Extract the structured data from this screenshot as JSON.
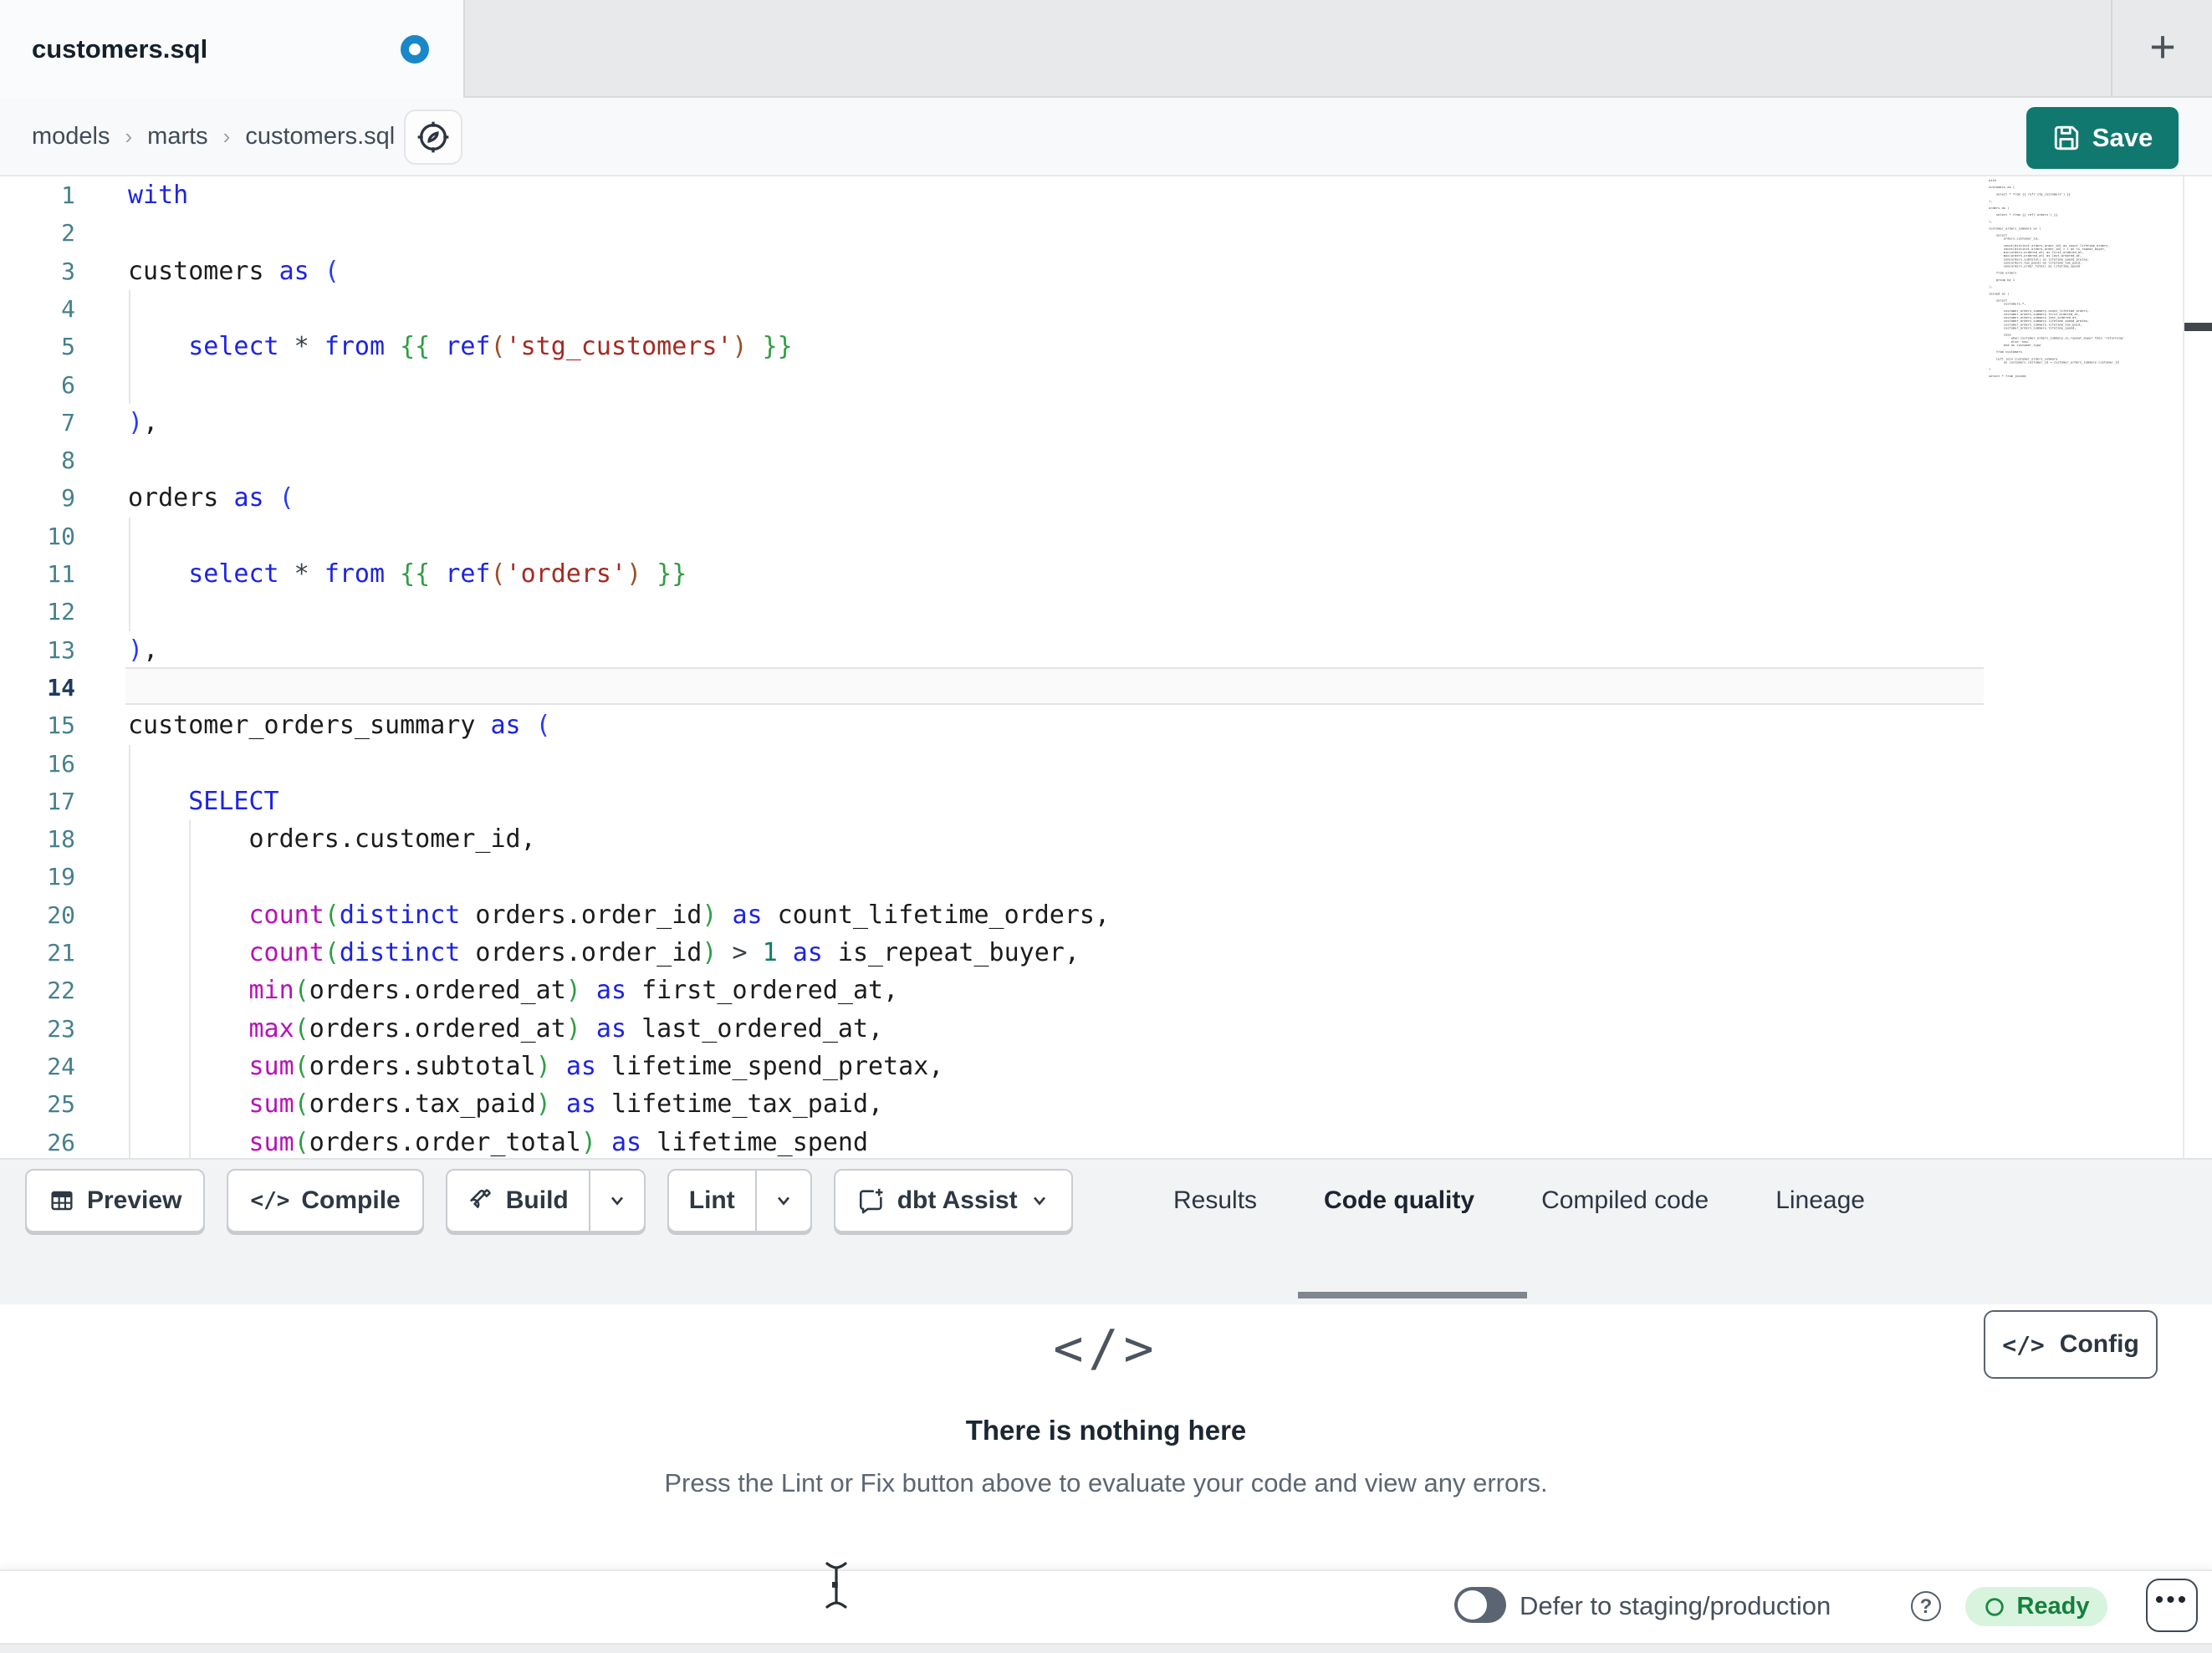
{
  "tabbar": {
    "tab_title": "customers.sql",
    "new_tab_label": "+"
  },
  "breadcrumb": {
    "items": [
      "models",
      "marts",
      "customers.sql"
    ],
    "separator": "›"
  },
  "save": {
    "label": "Save"
  },
  "editor": {
    "active_line": 14,
    "lines": [
      {
        "n": 1,
        "t": [
          [
            "kw",
            "with"
          ]
        ]
      },
      {
        "n": 2,
        "t": []
      },
      {
        "n": 3,
        "t": [
          [
            "id",
            "customers "
          ],
          [
            "kw",
            "as"
          ],
          [
            "id",
            " "
          ],
          [
            "pb",
            "("
          ]
        ]
      },
      {
        "n": 4,
        "t": []
      },
      {
        "n": 5,
        "t": [
          [
            "id",
            "    "
          ],
          [
            "kw",
            "select"
          ],
          [
            "op",
            " * "
          ],
          [
            "kw",
            "from"
          ],
          [
            "id",
            " "
          ],
          [
            "jj",
            "{{"
          ],
          [
            "id",
            " "
          ],
          [
            "kw",
            "ref"
          ],
          [
            "jp",
            "("
          ],
          [
            "str",
            "'stg_customers'"
          ],
          [
            "jp",
            ")"
          ],
          [
            "id",
            " "
          ],
          [
            "jj",
            "}}"
          ]
        ]
      },
      {
        "n": 6,
        "t": []
      },
      {
        "n": 7,
        "t": [
          [
            "pb",
            ")"
          ],
          [
            "id",
            ","
          ]
        ]
      },
      {
        "n": 8,
        "t": []
      },
      {
        "n": 9,
        "t": [
          [
            "id",
            "orders "
          ],
          [
            "kw",
            "as"
          ],
          [
            "id",
            " "
          ],
          [
            "pb",
            "("
          ]
        ]
      },
      {
        "n": 10,
        "t": []
      },
      {
        "n": 11,
        "t": [
          [
            "id",
            "    "
          ],
          [
            "kw",
            "select"
          ],
          [
            "op",
            " * "
          ],
          [
            "kw",
            "from"
          ],
          [
            "id",
            " "
          ],
          [
            "jj",
            "{{"
          ],
          [
            "id",
            " "
          ],
          [
            "kw",
            "ref"
          ],
          [
            "jp",
            "("
          ],
          [
            "str",
            "'orders'"
          ],
          [
            "jp",
            ")"
          ],
          [
            "id",
            " "
          ],
          [
            "jj",
            "}}"
          ]
        ]
      },
      {
        "n": 12,
        "t": []
      },
      {
        "n": 13,
        "t": [
          [
            "pb",
            ")"
          ],
          [
            "id",
            ","
          ]
        ]
      },
      {
        "n": 14,
        "t": []
      },
      {
        "n": 15,
        "t": [
          [
            "id",
            "customer_orders_summary "
          ],
          [
            "kw",
            "as"
          ],
          [
            "id",
            " "
          ],
          [
            "pb",
            "("
          ]
        ]
      },
      {
        "n": 16,
        "t": []
      },
      {
        "n": 17,
        "t": [
          [
            "id",
            "    "
          ],
          [
            "kw",
            "SELECT"
          ]
        ]
      },
      {
        "n": 18,
        "t": [
          [
            "id",
            "        orders.customer_id,"
          ]
        ]
      },
      {
        "n": 19,
        "t": []
      },
      {
        "n": 20,
        "t": [
          [
            "id",
            "        "
          ],
          [
            "fn",
            "count"
          ],
          [
            "pg",
            "("
          ],
          [
            "kw",
            "distinct"
          ],
          [
            "id",
            " orders.order_id"
          ],
          [
            "pg",
            ")"
          ],
          [
            "id",
            " "
          ],
          [
            "kw",
            "as"
          ],
          [
            "id",
            " count_lifetime_orders,"
          ]
        ]
      },
      {
        "n": 21,
        "t": [
          [
            "id",
            "        "
          ],
          [
            "fn",
            "count"
          ],
          [
            "pg",
            "("
          ],
          [
            "kw",
            "distinct"
          ],
          [
            "id",
            " orders.order_id"
          ],
          [
            "pg",
            ")"
          ],
          [
            "op",
            " > "
          ],
          [
            "num",
            "1"
          ],
          [
            "id",
            " "
          ],
          [
            "kw",
            "as"
          ],
          [
            "id",
            " is_repeat_buyer,"
          ]
        ]
      },
      {
        "n": 22,
        "t": [
          [
            "id",
            "        "
          ],
          [
            "fn",
            "min"
          ],
          [
            "pg",
            "("
          ],
          [
            "id",
            "orders.ordered_at"
          ],
          [
            "pg",
            ")"
          ],
          [
            "id",
            " "
          ],
          [
            "kw",
            "as"
          ],
          [
            "id",
            " first_ordered_at,"
          ]
        ]
      },
      {
        "n": 23,
        "t": [
          [
            "id",
            "        "
          ],
          [
            "fn",
            "max"
          ],
          [
            "pg",
            "("
          ],
          [
            "id",
            "orders.ordered_at"
          ],
          [
            "pg",
            ")"
          ],
          [
            "id",
            " "
          ],
          [
            "kw",
            "as"
          ],
          [
            "id",
            " last_ordered_at,"
          ]
        ]
      },
      {
        "n": 24,
        "t": [
          [
            "id",
            "        "
          ],
          [
            "fn",
            "sum"
          ],
          [
            "pg",
            "("
          ],
          [
            "id",
            "orders.subtotal"
          ],
          [
            "pg",
            ")"
          ],
          [
            "id",
            " "
          ],
          [
            "kw",
            "as"
          ],
          [
            "id",
            " lifetime_spend_pretax,"
          ]
        ]
      },
      {
        "n": 25,
        "t": [
          [
            "id",
            "        "
          ],
          [
            "fn",
            "sum"
          ],
          [
            "pg",
            "("
          ],
          [
            "id",
            "orders.tax_paid"
          ],
          [
            "pg",
            ")"
          ],
          [
            "id",
            " "
          ],
          [
            "kw",
            "as"
          ],
          [
            "id",
            " lifetime_tax_paid,"
          ]
        ]
      },
      {
        "n": 26,
        "t": [
          [
            "id",
            "        "
          ],
          [
            "fn",
            "sum"
          ],
          [
            "pg",
            "("
          ],
          [
            "id",
            "orders.order_total"
          ],
          [
            "pg",
            ")"
          ],
          [
            "id",
            " "
          ],
          [
            "kw",
            "as"
          ],
          [
            "id",
            " lifetime_spend"
          ]
        ]
      }
    ],
    "minimap_lines": [
      "with",
      "",
      "customers as (",
      "",
      "    select * from {{ ref('stg_customers') }}",
      "",
      "),",
      "",
      "orders as (",
      "",
      "    select * from {{ ref('orders') }}",
      "",
      "),",
      "",
      "customer_orders_summary as (",
      "",
      "    select",
      "        orders.customer_id,",
      "",
      "        count(distinct orders.order_id) as count_lifetime_orders,",
      "        count(distinct orders.order_id) > 1 as is_repeat_buyer,",
      "        min(orders.ordered_at) as first_ordered_at,",
      "        max(orders.ordered_at) as last_ordered_at,",
      "        sum(orders.subtotal) as lifetime_spend_pretax,",
      "        sum(orders.tax_paid) as lifetime_tax_paid,",
      "        sum(orders.order_total) as lifetime_spend",
      "",
      "    from orders",
      "",
      "    group by 1",
      "",
      "),",
      "",
      "joined as (",
      "",
      "    select",
      "        customers.*,",
      "",
      "        customer_orders_summary.count_lifetime_orders,",
      "        customer_orders_summary.first_ordered_at,",
      "        customer_orders_summary.last_ordered_at,",
      "        customer_orders_summary.lifetime_spend_pretax,",
      "        customer_orders_summary.lifetime_tax_paid,",
      "        customer_orders_summary.lifetime_spend,",
      "",
      "        case",
      "            when customer_orders_summary.is_repeat_buyer then 'returning'",
      "            else 'new'",
      "        end as customer_type",
      "",
      "    from customers",
      "",
      "    left join customer_orders_summary",
      "        on customers.customer_id = customer_orders_summary.customer_id",
      "",
      ")",
      "",
      "select * from joined"
    ]
  },
  "toolbar": {
    "preview_label": "Preview",
    "compile_label": "Compile",
    "compile_icon_text": "</>",
    "build_label": "Build",
    "lint_label": "Lint",
    "assist_label": "dbt Assist"
  },
  "panel_tabs": [
    {
      "label": "Results",
      "active": false
    },
    {
      "label": "Code quality",
      "active": true
    },
    {
      "label": "Compiled code",
      "active": false
    },
    {
      "label": "Lineage",
      "active": false
    }
  ],
  "panel": {
    "empty_icon_text": "</>",
    "title": "There is nothing here",
    "subtitle": "Press the Lint or Fix button above to evaluate your code and view any errors.",
    "config_label": "Config",
    "config_icon_text": "</>"
  },
  "statusbar": {
    "defer_label": "Defer to staging/production",
    "ready_label": "Ready",
    "more_label": "•••"
  },
  "colors": {
    "save_teal": "#11786F",
    "dirty_dot_blue": "#1A87C9",
    "ready_green_bg": "#D9F4DE",
    "ready_green_text": "#14803C",
    "syntax_keyword": "#1D24E0",
    "syntax_function": "#B613B6",
    "syntax_paren_green": "#2F9E44",
    "syntax_paren_blue": "#2A3BF0",
    "syntax_jinja": "#2F9E44",
    "syntax_string": "#A52A21",
    "syntax_number": "#0E7D6E",
    "line_number": "#45808F",
    "line_number_active": "#1E3A5F"
  }
}
